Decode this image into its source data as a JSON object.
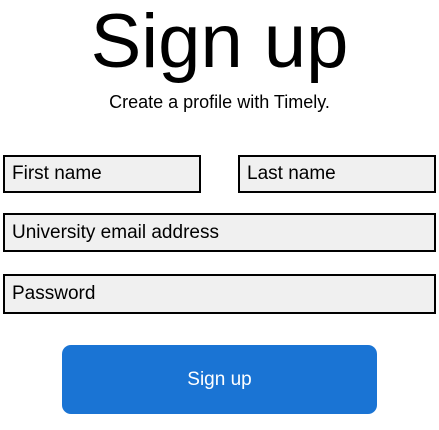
{
  "header": {
    "title": "Sign up",
    "subtitle": "Create a profile with Timely."
  },
  "form": {
    "first_name": {
      "placeholder": "First name",
      "value": ""
    },
    "last_name": {
      "placeholder": "Last name",
      "value": ""
    },
    "email": {
      "placeholder": "University email address",
      "value": ""
    },
    "password": {
      "placeholder": "Password",
      "value": ""
    },
    "submit_label": "Sign up"
  },
  "colors": {
    "accent": "#1a74d4",
    "field_background": "#f0f0f0",
    "field_border": "#000000"
  }
}
